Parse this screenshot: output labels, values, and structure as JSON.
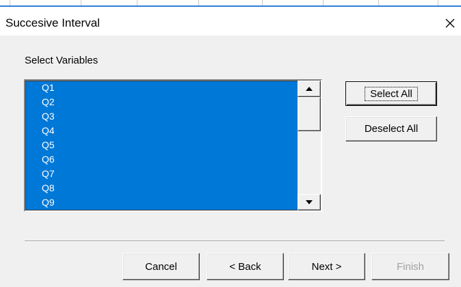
{
  "window": {
    "title": "Succesive Interval",
    "close_icon": "close-icon"
  },
  "variables_label": "Select Variables",
  "variables_list": {
    "items": [
      "Q1",
      "Q2",
      "Q3",
      "Q4",
      "Q5",
      "Q6",
      "Q7",
      "Q8",
      "Q9"
    ],
    "selection_color": "#0078d7",
    "all_selected": true
  },
  "side_buttons": {
    "select_all": "Select All",
    "deselect_all": "Deselect All"
  },
  "footer_buttons": {
    "cancel": "Cancel",
    "back": "< Back",
    "next": "Next >",
    "finish": "Finish"
  },
  "colors": {
    "dialog_bg": "#f0f0f0",
    "disabled_text": "#a0a0a0"
  }
}
